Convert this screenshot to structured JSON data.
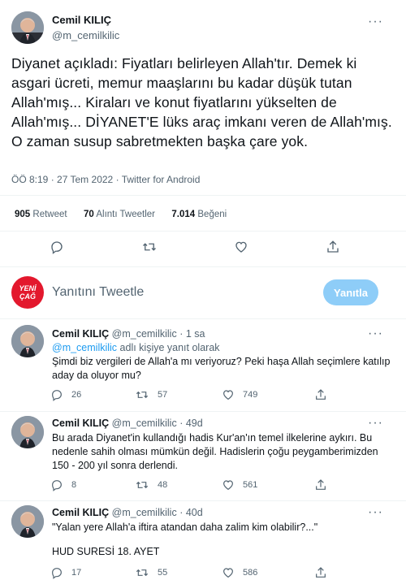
{
  "tweet": {
    "author_name": "Cemil KILIÇ",
    "author_handle": "@m_cemilkilic",
    "text": "Diyanet açıkladı: Fiyatları belirleyen Allah'tır. Demek ki asgari ücreti, memur maaşlarını bu kadar düşük tutan Allah'mış... Kiraları ve konut fiyatlarını yükselten de Allah'mış... DİYANET'E lüks araç imkanı veren de Allah'mış. O zaman susup sabretmekten başka çare yok.",
    "time": "ÖÖ 8:19",
    "date": "27 Tem 2022",
    "source": "Twitter for Android",
    "retweets": "905",
    "retweets_label": "Retweet",
    "quotes": "70",
    "quotes_label": "Alıntı Tweetler",
    "likes": "7.014",
    "likes_label": "Beğeni"
  },
  "compose": {
    "avatar_text_line1": "YENİ",
    "avatar_text_line2": "ÇAĞ",
    "placeholder": "Yanıtını Tweetle",
    "button_label": "Yanıtla"
  },
  "replies": [
    {
      "author_name": "Cemil KILIÇ",
      "author_handle": "@m_cemilkilic",
      "time": "1 sa",
      "replying_to": "@m_cemilkilic",
      "replying_suffix": "adlı kişiye yanıt olarak",
      "text": "Şimdi biz vergileri de Allah'a mı veriyoruz? Peki haşa Allah seçimlere katılıp aday da oluyor mu?",
      "replies": "26",
      "retweets": "57",
      "likes": "749"
    },
    {
      "author_name": "Cemil KILIÇ",
      "author_handle": "@m_cemilkilic",
      "time": "49d",
      "text": "Bu arada Diyanet'in kullandığı hadis Kur'an'ın temel ilkelerine aykırı. Bu nedenle sahih olması mümkün değil. Hadislerin çoğu peygamberimizden 150 - 200 yıl sonra derlendi.",
      "replies": "8",
      "retweets": "48",
      "likes": "561"
    },
    {
      "author_name": "Cemil KILIÇ",
      "author_handle": "@m_cemilkilic",
      "time": "40d",
      "text": "\"Yalan yere Allah'a iftira atandan daha zalim kim olabilir?...\"",
      "text2": "HUD SURESİ 18. AYET",
      "replies": "17",
      "retweets": "55",
      "likes": "586"
    }
  ],
  "colors": {
    "accent": "#1d9bf0",
    "reply_button": "#8ecdf8",
    "secondary_text": "#536471",
    "brand_red": "#e3182d"
  }
}
